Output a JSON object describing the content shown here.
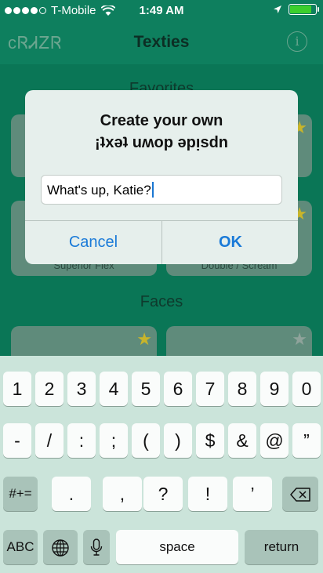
{
  "status": {
    "carrier": "T-Mobile",
    "time": "1:49 AM",
    "signal_bars": 4,
    "battery_level": 0.85,
    "battery_color": "#3ccf2d"
  },
  "nav": {
    "left_label": "cᏒᏗᏃᏒ",
    "title": "Texties",
    "info_icon": "i"
  },
  "sections": {
    "favorites_title": "Favorites",
    "faces_title": "Faces"
  },
  "tiles": {
    "favorites": [
      {
        "label": "",
        "starred": true
      },
      {
        "label": "Superior Flex",
        "starred": false
      },
      {
        "label": "Double / Scream",
        "starred": true
      }
    ],
    "faces": [
      {
        "label": "",
        "starred": true
      },
      {
        "label": "",
        "starred": false
      }
    ]
  },
  "alert": {
    "title": "Create your own",
    "message": "¡ʇxǝʇ uʍop ǝpᴉsdn",
    "input_value": "What's up, Katie?",
    "cancel_label": "Cancel",
    "ok_label": "OK"
  },
  "keyboard": {
    "row1": [
      "1",
      "2",
      "3",
      "4",
      "5",
      "6",
      "7",
      "8",
      "9",
      "0"
    ],
    "row2": [
      "-",
      "/",
      ":",
      ";",
      "(",
      ")",
      "$",
      "&",
      "@",
      "”"
    ],
    "row3": [
      ".",
      ",",
      "?",
      "!",
      "’"
    ],
    "toggle_label": "#+=",
    "abc_label": "ABC",
    "space_label": "space",
    "return_label": "return"
  },
  "colors": {
    "accent": "#1a7ad8",
    "background": "#0e7f5e",
    "star_gold": "#c8b52a"
  }
}
